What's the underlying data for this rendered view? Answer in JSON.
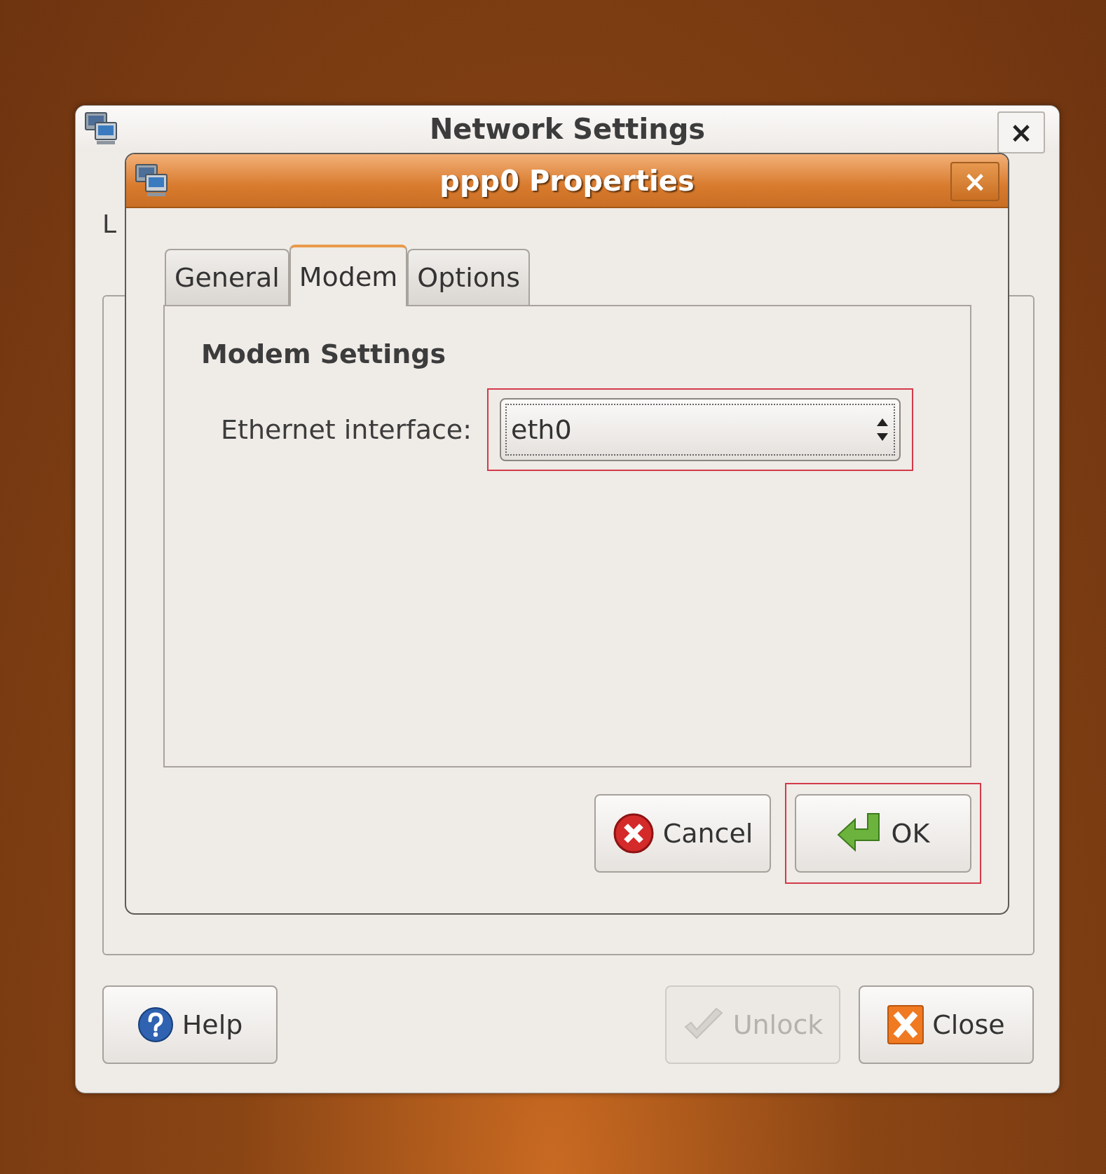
{
  "main_window": {
    "title": "Network Settings",
    "close_glyph": "×",
    "covered_label": "L",
    "buttons": [
      {
        "label": "Help",
        "kind": "help",
        "disabled": false
      },
      {
        "label": "Unlock",
        "kind": "unlock",
        "disabled": true
      },
      {
        "label": "Close",
        "kind": "close",
        "disabled": false
      }
    ]
  },
  "dialog": {
    "title": "ppp0 Properties",
    "close_glyph": "×",
    "tabs": [
      {
        "label": "General",
        "selected": false
      },
      {
        "label": "Modem",
        "selected": true
      },
      {
        "label": "Options",
        "selected": false
      }
    ],
    "section_title": "Modem Settings",
    "field": {
      "label": "Ethernet interface:",
      "value": "eth0",
      "highlighted": true
    },
    "buttons": [
      {
        "label": "Cancel",
        "kind": "cancel",
        "highlighted": false
      },
      {
        "label": "OK",
        "kind": "ok",
        "highlighted": true
      }
    ]
  }
}
